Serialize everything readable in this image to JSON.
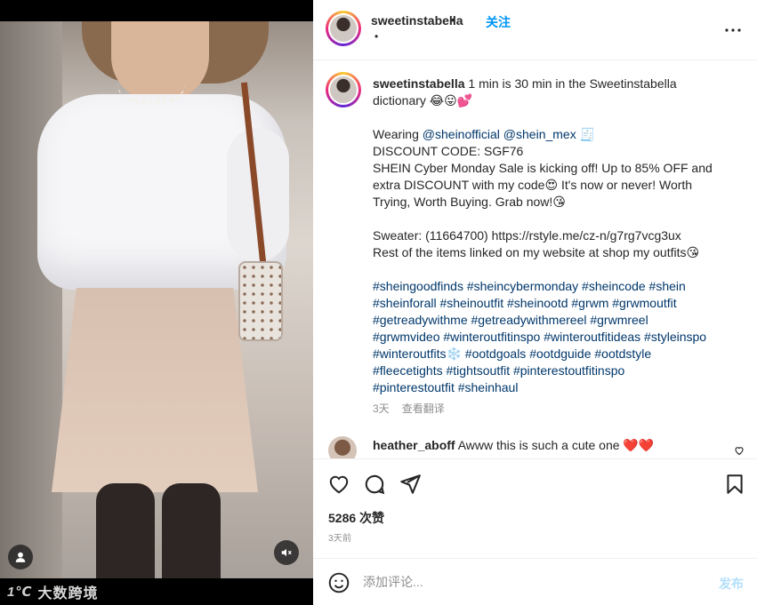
{
  "post": {
    "username": "sweetinstabella",
    "header_dot": "•",
    "follow_label": "关注",
    "sub_dot": "•"
  },
  "caption": {
    "username": "sweetinstabella",
    "lines_p1": [
      "1 min is 30 min in the Sweetinstabella",
      "dictionary 😂😛💕"
    ],
    "p2": {
      "wearing_prefix": "Wearing ",
      "mention1": "@sheinofficial",
      "mention2": "@shein_mex",
      "wearing_suffix": " 🧾",
      "lines": [
        "DISCOUNT CODE: SGF76",
        "SHEIN Cyber Monday Sale is kicking off! Up to 85% OFF and",
        "extra DISCOUNT with my code😍 It's now or never! Worth",
        "Trying, Worth Buying. Grab now!😘"
      ]
    },
    "p3": [
      "Sweater: (11664700) https://rstyle.me/cz-n/g7rg7vcg3ux",
      "Rest of the items linked on my website at shop my outfits😘"
    ],
    "hashtag_lines": [
      "#sheingoodfinds #sheincybermonday #sheincode #shein",
      "#sheinforall #sheinoutfit #sheinootd #grwm #grwmoutfit",
      "#getreadywithme #getreadywithmereel #grwmreel",
      "#grwmvideo #winteroutfitinspo #winteroutfitideas #styleinspo",
      "#winteroutfits❄️ #ootdgoals #ootdguide #ootdstyle",
      "#fleecetights #tightsoutfit #pinterestoutfitinspo",
      "#pinterestoutfit #sheinhaul"
    ],
    "age": "3天",
    "see_translation": "查看翻译"
  },
  "comment": {
    "username": "heather_aboff",
    "text": " Awww this is such a cute one ❤️❤️"
  },
  "actions": {
    "likes": "5286 次赞",
    "time": "3天前"
  },
  "add_comment": {
    "placeholder": "添加评论...",
    "post_label": "发布"
  },
  "watermark": {
    "logo": "1℃",
    "text": "大数跨境"
  },
  "icons": {
    "more": "more-options-icon",
    "like": "heart-icon",
    "comment": "comment-bubble-icon",
    "share": "paper-plane-icon",
    "save": "bookmark-icon",
    "emoji": "smiley-icon",
    "mute": "speaker-muted-icon",
    "tag": "user-tag-icon"
  },
  "colors": {
    "link": "#00376b",
    "follow": "#0095f6",
    "post_disabled": "#b2dffc",
    "meta": "#8e8e8e"
  }
}
